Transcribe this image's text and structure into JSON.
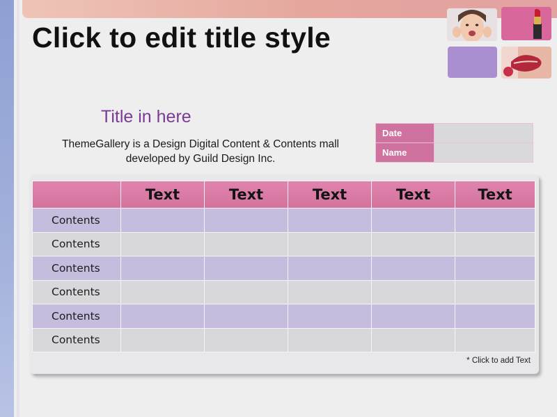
{
  "slide": {
    "title": "Click to edit title style",
    "subtitle": "Title in here",
    "description_line1": "ThemeGallery  is a Design Digital Content & Contents mall",
    "description_line2": "developed by Guild Design Inc.",
    "meta": [
      {
        "label": "Date",
        "value": ""
      },
      {
        "label": "Name",
        "value": ""
      }
    ],
    "table": {
      "corner": "",
      "headers": [
        "Text",
        "Text",
        "Text",
        "Text",
        "Text"
      ],
      "rows": [
        {
          "label": "Contents",
          "cells": [
            "",
            "",
            "",
            "",
            ""
          ]
        },
        {
          "label": "Contents",
          "cells": [
            "",
            "",
            "",
            "",
            ""
          ]
        },
        {
          "label": "Contents",
          "cells": [
            "",
            "",
            "",
            "",
            ""
          ]
        },
        {
          "label": "Contents",
          "cells": [
            "",
            "",
            "",
            "",
            ""
          ]
        },
        {
          "label": "Contents",
          "cells": [
            "",
            "",
            "",
            "",
            ""
          ]
        },
        {
          "label": "Contents",
          "cells": [
            "",
            "",
            "",
            "",
            ""
          ]
        }
      ]
    },
    "footnote": "* Click to add Text",
    "colors": {
      "header_pink": "#d3729d",
      "row_purple": "#c6bcdd",
      "row_gray": "#d8d8da",
      "subtitle_purple": "#7b3a93",
      "left_bar_blue": "#8ea0d2",
      "top_bar_peach": "#e4a69d"
    },
    "decor_images": [
      "smiling-girl-photo",
      "lipstick-photo",
      "purple-tile",
      "lips-photo"
    ]
  }
}
